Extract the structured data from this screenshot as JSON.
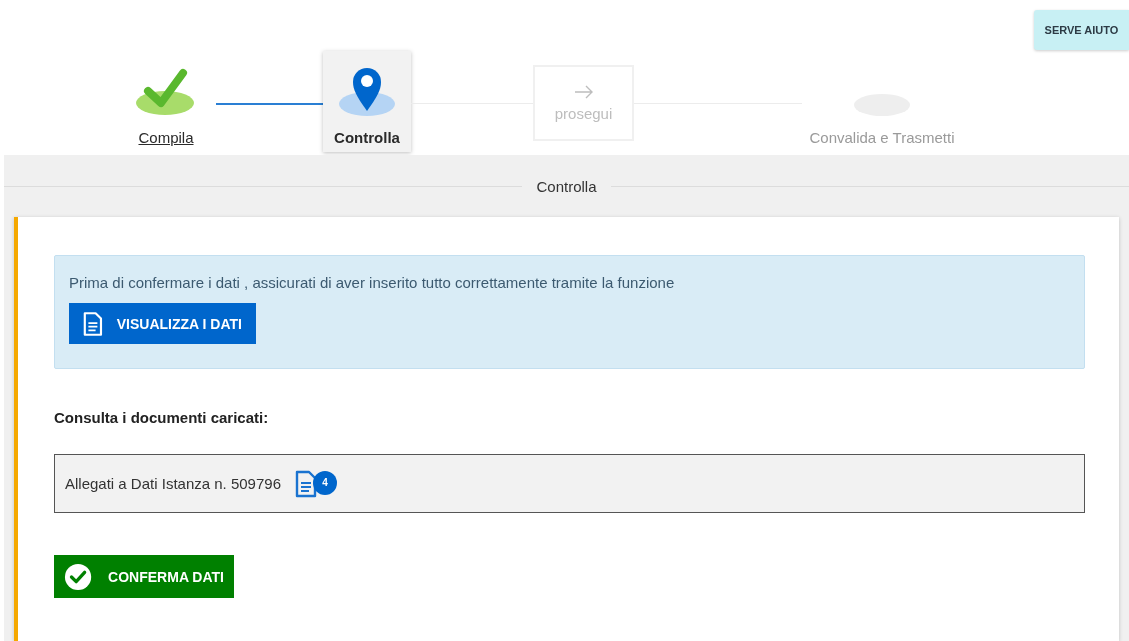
{
  "help_button": {
    "label": "SERVE AIUTO"
  },
  "steps": [
    {
      "kind": "step",
      "label": "Compila",
      "completed": true,
      "selected": false
    },
    {
      "kind": "step",
      "label": "Controlla",
      "completed": false,
      "selected": true
    },
    {
      "kind": "action",
      "label": "prosegui",
      "disabled": true
    },
    {
      "kind": "step",
      "label": "Convalida e Trasmetti",
      "completed": false,
      "selected": false
    }
  ],
  "section_title": "Controlla",
  "info": {
    "text": "Prima di confermare i dati , assicurati di aver inserito tutto correttamente tramite la funzione",
    "button": "VISUALIZZA I DATI"
  },
  "documents": {
    "heading": "Consulta i documenti caricati:",
    "item": "Allegati a Dati Istanza n. 509796",
    "count": "4"
  },
  "confirm_button": "CONFERMA DATI"
}
